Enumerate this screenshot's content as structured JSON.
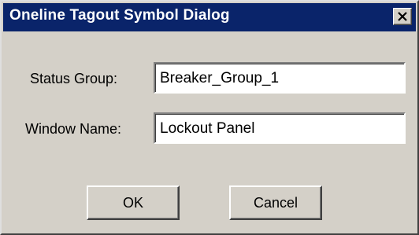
{
  "window": {
    "title": "Oneline Tagout Symbol Dialog",
    "close_icon": "close-icon",
    "titlebar_color": "#0a246a",
    "face_color": "#d4d0c8"
  },
  "form": {
    "status_group_label": "Status Group:",
    "status_group_value": "Breaker_Group_1",
    "window_name_label": "Window Name:",
    "window_name_value": "Lockout Panel"
  },
  "buttons": {
    "ok_label": "OK",
    "cancel_label": "Cancel"
  }
}
